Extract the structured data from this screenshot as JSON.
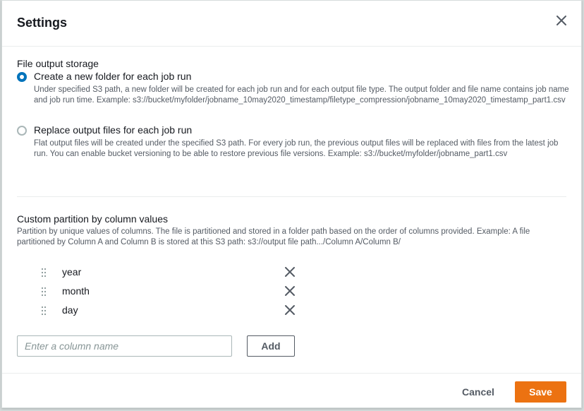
{
  "modal": {
    "title": "Settings",
    "close_icon": "close-icon"
  },
  "file_output": {
    "label": "File output storage",
    "options": [
      {
        "label": "Create a new folder for each job run",
        "description": "Under specified S3 path, a new folder will be created for each job run and for each output file type. The output folder and file name contains job name and job run time. Example: s3://bucket/myfolder/jobname_10may2020_timestamp/filetype_compression/jobname_10may2020_timestamp_part1.csv",
        "selected": true
      },
      {
        "label": "Replace output files for each job run",
        "description": "Flat output files will be created under the specified S3 path. For every job run, the previous output files will be replaced with files from the latest job run. You can enable bucket versioning to be able to restore previous file versions. Example: s3://bucket/myfolder/jobname_part1.csv",
        "selected": false
      }
    ]
  },
  "partition": {
    "label": "Custom partition by column values",
    "description": "Partition by unique values of columns. The file is partitioned and stored in a folder path based on the order of columns provided. Example: A file partitioned by Column A and Column B is stored at this S3 path: s3://output file path.../Column A/Column B/",
    "columns": [
      "year",
      "month",
      "day"
    ],
    "input": {
      "value": "",
      "placeholder": "Enter a column name"
    },
    "add_label": "Add"
  },
  "footer": {
    "cancel_label": "Cancel",
    "save_label": "Save"
  },
  "colors": {
    "primary": "#ec7211",
    "radio_selected": "#0073bb",
    "text": "#16191f",
    "muted_text": "#545b64"
  }
}
